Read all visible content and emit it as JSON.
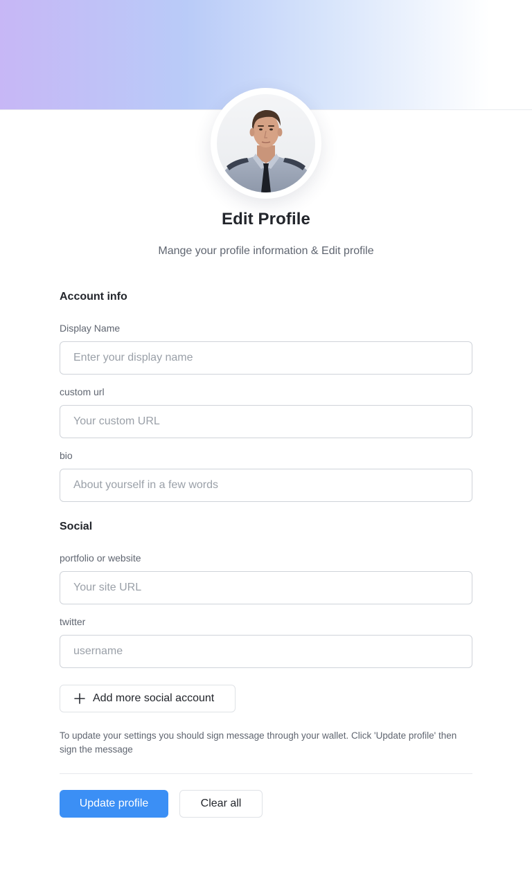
{
  "header": {
    "title": "Edit Profile",
    "subtitle": "Mange your profile information & Edit profile",
    "avatar_alt": "profile-avatar"
  },
  "account_info": {
    "heading": "Account info",
    "display_name": {
      "label": "Display Name",
      "placeholder": "Enter your display name",
      "value": ""
    },
    "custom_url": {
      "label": "custom url",
      "placeholder": "Your custom URL",
      "value": ""
    },
    "bio": {
      "label": "bio",
      "placeholder": "About yourself in a few words",
      "value": ""
    }
  },
  "social": {
    "heading": "Social",
    "website": {
      "label": "portfolio or website",
      "placeholder": "Your site URL",
      "value": ""
    },
    "twitter": {
      "label": "twitter",
      "placeholder": "username",
      "value": ""
    },
    "add_more_label": "Add more social account"
  },
  "note": "To update your settings you should sign message through your wallet. Click 'Update profile' then sign the message",
  "actions": {
    "update_label": "Update profile",
    "clear_label": "Clear all"
  },
  "icons": {
    "add": "plus-icon"
  },
  "colors": {
    "primary": "#3b8ff5",
    "banner_start": "#c7b7f6",
    "banner_mid": "#b9cbf8"
  }
}
